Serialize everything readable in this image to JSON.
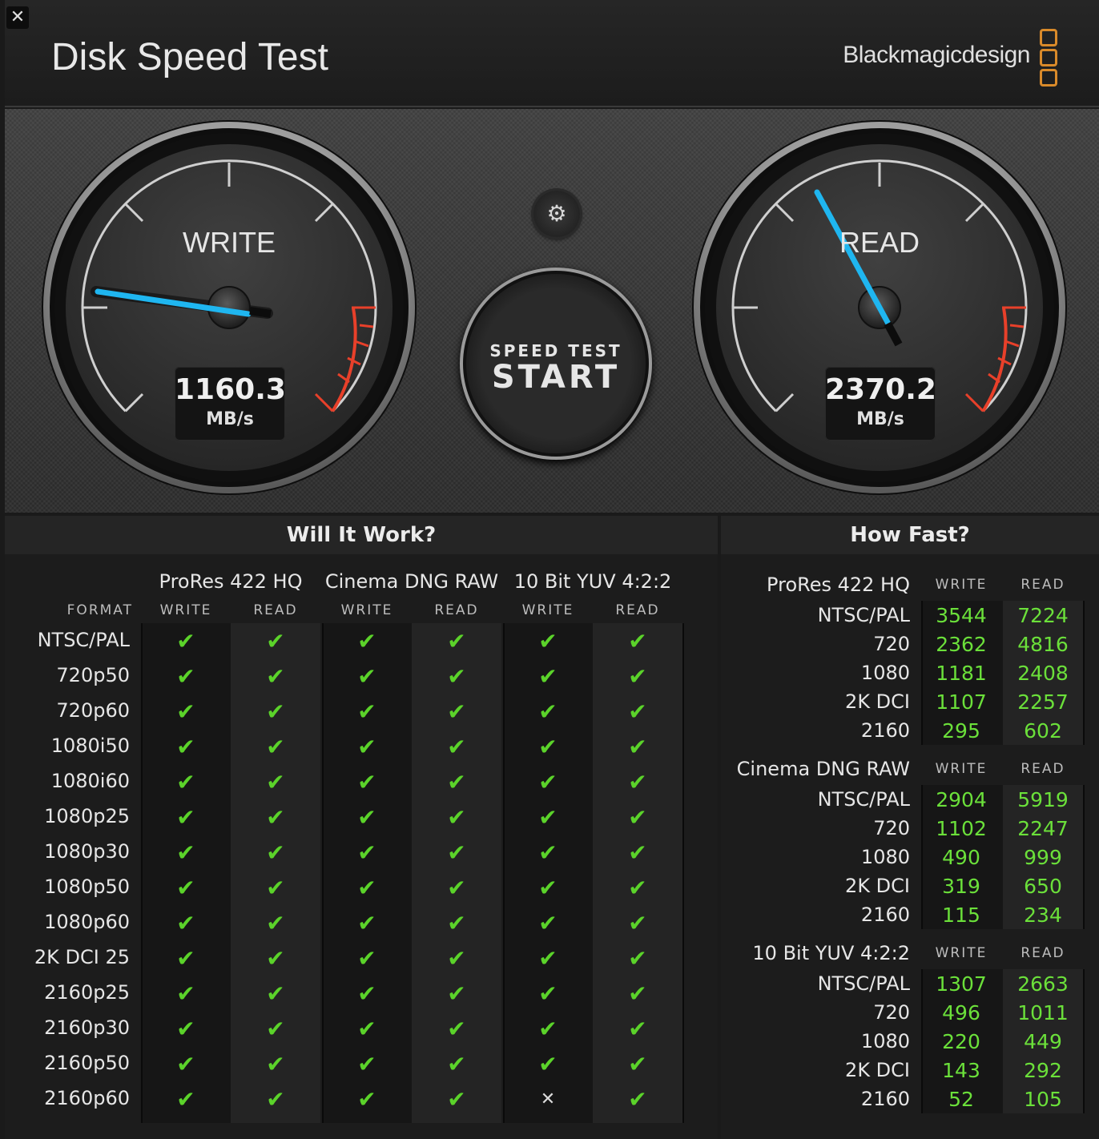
{
  "app": {
    "title": "Disk Speed Test",
    "brand": "Blackmagicdesign",
    "close_glyph": "✕",
    "settings_glyph": "⚙"
  },
  "gauges": {
    "write": {
      "label": "WRITE",
      "value": "1160.3",
      "unit": "MB/s"
    },
    "read": {
      "label": "READ",
      "value": "2370.2",
      "unit": "MB/s"
    }
  },
  "start_button": {
    "line1": "SPEED TEST",
    "line2": "START"
  },
  "will_it_work": {
    "title": "Will It Work?",
    "format_header": "FORMAT",
    "codecs": [
      "ProRes 422 HQ",
      "Cinema DNG RAW",
      "10 Bit YUV 4:2:2"
    ],
    "subcols": [
      "WRITE",
      "READ",
      "WRITE",
      "READ",
      "WRITE",
      "READ"
    ],
    "rows": [
      {
        "format": "NTSC/PAL",
        "marks": [
          "✔",
          "✔",
          "✔",
          "✔",
          "✔",
          "✔"
        ]
      },
      {
        "format": "720p50",
        "marks": [
          "✔",
          "✔",
          "✔",
          "✔",
          "✔",
          "✔"
        ]
      },
      {
        "format": "720p60",
        "marks": [
          "✔",
          "✔",
          "✔",
          "✔",
          "✔",
          "✔"
        ]
      },
      {
        "format": "1080i50",
        "marks": [
          "✔",
          "✔",
          "✔",
          "✔",
          "✔",
          "✔"
        ]
      },
      {
        "format": "1080i60",
        "marks": [
          "✔",
          "✔",
          "✔",
          "✔",
          "✔",
          "✔"
        ]
      },
      {
        "format": "1080p25",
        "marks": [
          "✔",
          "✔",
          "✔",
          "✔",
          "✔",
          "✔"
        ]
      },
      {
        "format": "1080p30",
        "marks": [
          "✔",
          "✔",
          "✔",
          "✔",
          "✔",
          "✔"
        ]
      },
      {
        "format": "1080p50",
        "marks": [
          "✔",
          "✔",
          "✔",
          "✔",
          "✔",
          "✔"
        ]
      },
      {
        "format": "1080p60",
        "marks": [
          "✔",
          "✔",
          "✔",
          "✔",
          "✔",
          "✔"
        ]
      },
      {
        "format": "2K DCI 25",
        "marks": [
          "✔",
          "✔",
          "✔",
          "✔",
          "✔",
          "✔"
        ]
      },
      {
        "format": "2160p25",
        "marks": [
          "✔",
          "✔",
          "✔",
          "✔",
          "✔",
          "✔"
        ]
      },
      {
        "format": "2160p30",
        "marks": [
          "✔",
          "✔",
          "✔",
          "✔",
          "✔",
          "✔"
        ]
      },
      {
        "format": "2160p50",
        "marks": [
          "✔",
          "✔",
          "✔",
          "✔",
          "✔",
          "✔"
        ]
      },
      {
        "format": "2160p60",
        "marks": [
          "✔",
          "✔",
          "✔",
          "✔",
          "✕",
          "✔"
        ]
      }
    ]
  },
  "how_fast": {
    "title": "How Fast?",
    "groups": [
      {
        "codec": "ProRes 422 HQ",
        "write_header": "WRITE",
        "read_header": "READ",
        "rows": [
          {
            "format": "NTSC/PAL",
            "write": "3544",
            "read": "7224"
          },
          {
            "format": "720",
            "write": "2362",
            "read": "4816"
          },
          {
            "format": "1080",
            "write": "1181",
            "read": "2408"
          },
          {
            "format": "2K DCI",
            "write": "1107",
            "read": "2257"
          },
          {
            "format": "2160",
            "write": "295",
            "read": "602"
          }
        ]
      },
      {
        "codec": "Cinema DNG RAW",
        "write_header": "WRITE",
        "read_header": "READ",
        "rows": [
          {
            "format": "NTSC/PAL",
            "write": "2904",
            "read": "5919"
          },
          {
            "format": "720",
            "write": "1102",
            "read": "2247"
          },
          {
            "format": "1080",
            "write": "490",
            "read": "999"
          },
          {
            "format": "2K DCI",
            "write": "319",
            "read": "650"
          },
          {
            "format": "2160",
            "write": "115",
            "read": "234"
          }
        ]
      },
      {
        "codec": "10 Bit YUV 4:2:2",
        "write_header": "WRITE",
        "read_header": "READ",
        "rows": [
          {
            "format": "NTSC/PAL",
            "write": "1307",
            "read": "2663"
          },
          {
            "format": "720",
            "write": "496",
            "read": "1011"
          },
          {
            "format": "1080",
            "write": "220",
            "read": "449"
          },
          {
            "format": "2K DCI",
            "write": "143",
            "read": "292"
          },
          {
            "format": "2160",
            "write": "52",
            "read": "105"
          }
        ]
      }
    ]
  },
  "colors": {
    "needle": "#1fb6f0",
    "check": "#5bd32a",
    "value_green": "#6be03a",
    "redline": "#e8402a",
    "brand_logo": "#d98a2a"
  },
  "icons": {
    "close": "close-icon",
    "settings": "gear-icon",
    "check": "checkmark-icon",
    "cross": "cross-icon",
    "logo": "blackmagic-logo-icon"
  }
}
